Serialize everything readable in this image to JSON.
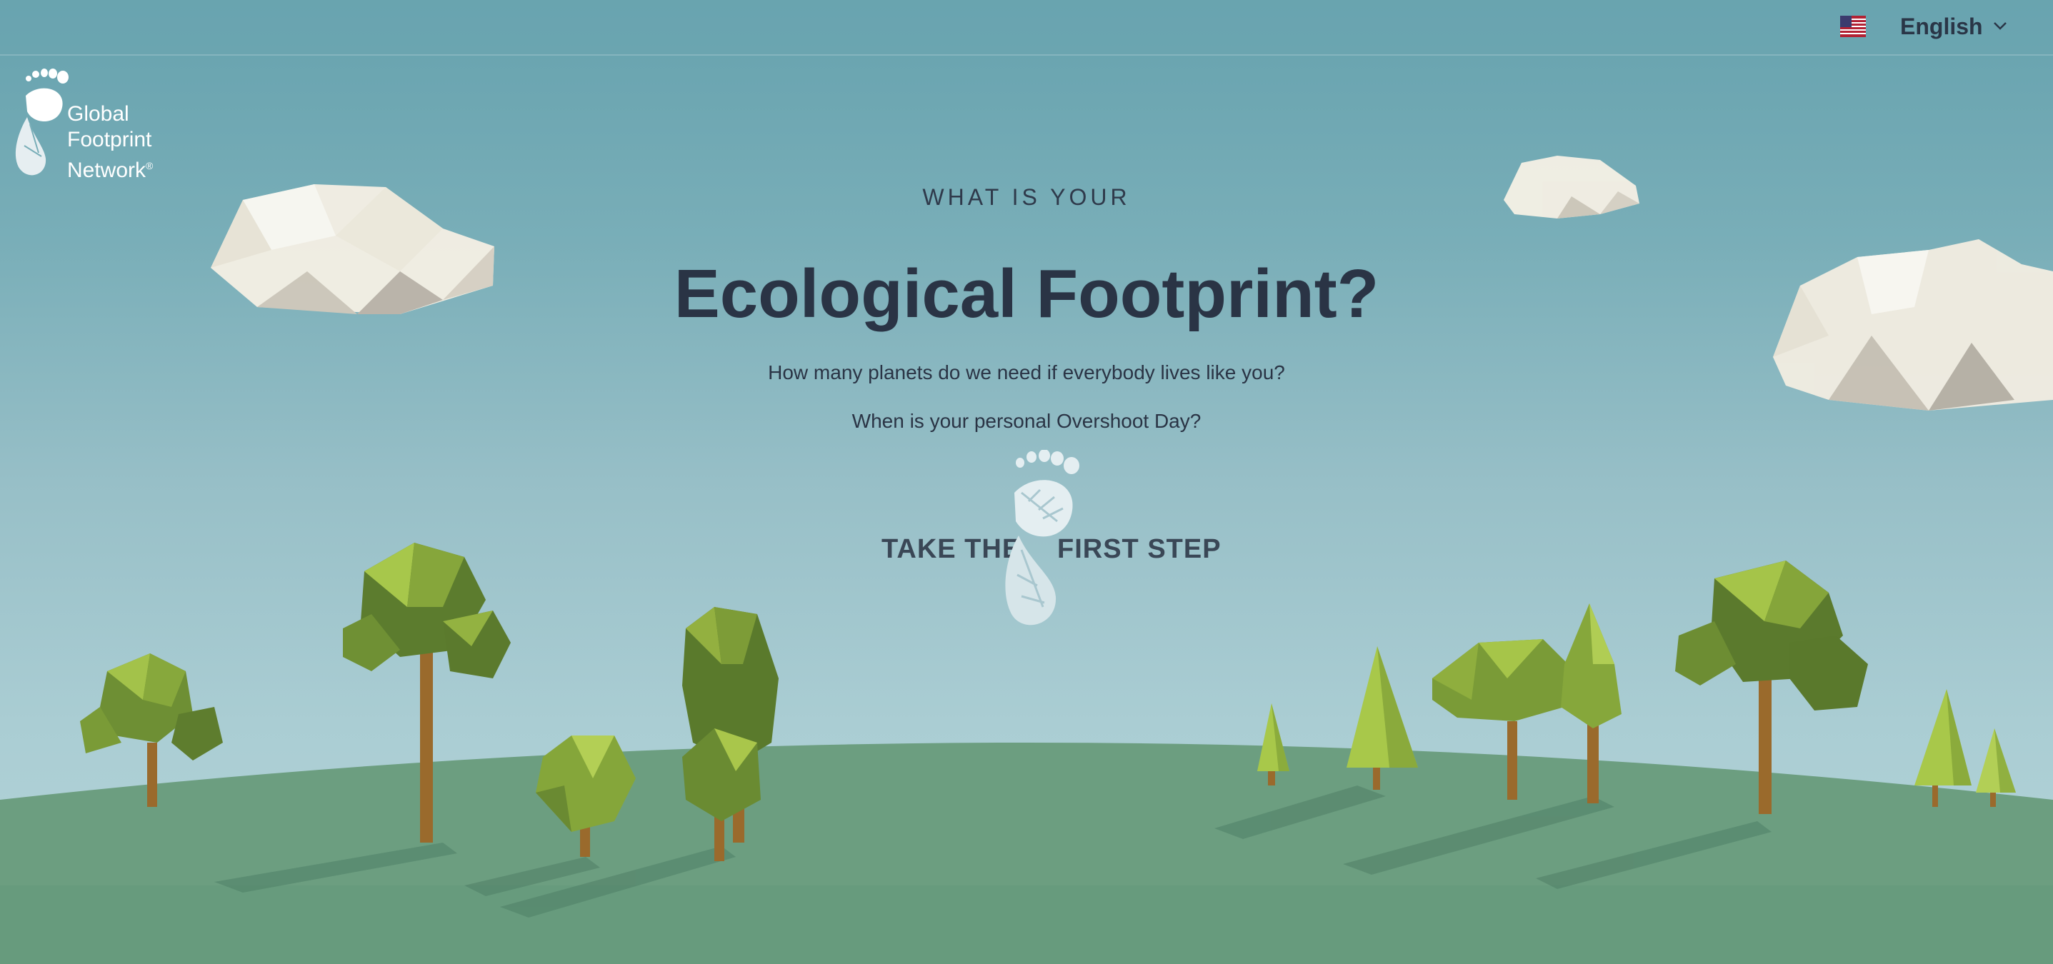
{
  "header": {
    "language": {
      "label": "English",
      "flag_icon": "us-flag-icon"
    }
  },
  "logo": {
    "lines": [
      "Global",
      "Footprint",
      "Network"
    ],
    "registered": "®",
    "color": "#ffffff"
  },
  "hero": {
    "eyebrow": "WHAT IS YOUR",
    "title": "Ecological Footprint?",
    "question1": "How many planets do we need if everybody lives like you?",
    "question2": "When is your personal Overshoot Day?"
  },
  "cta": {
    "left_text": "TAKE THE",
    "right_text": "FIRST STEP",
    "icon": "footprint-icon"
  },
  "colors": {
    "sky_top": "#66a2ae",
    "sky_bottom": "#b5d5da",
    "ground": "#6c9e80",
    "text_dark": "#2a3445",
    "tree_light": "#a8c84a",
    "tree_dark": "#5b7a2e",
    "trunk": "#9a6a2c"
  }
}
